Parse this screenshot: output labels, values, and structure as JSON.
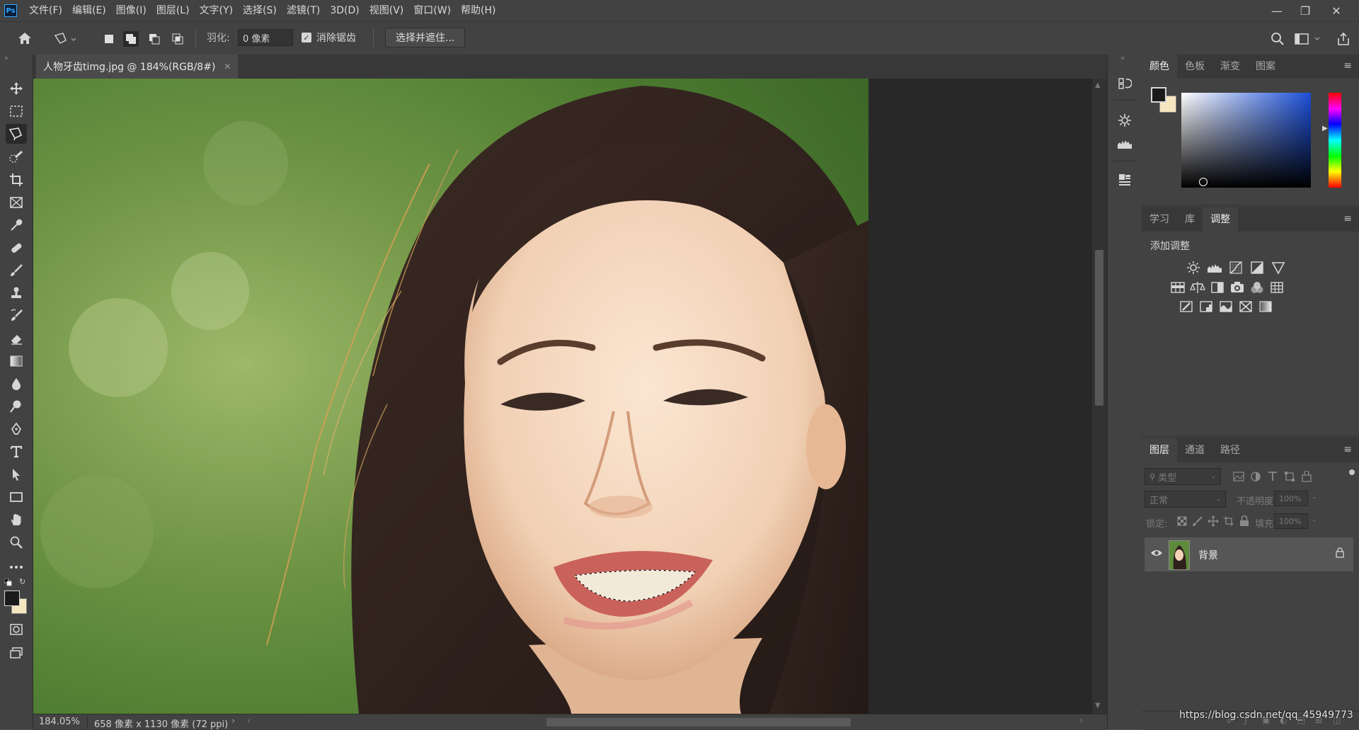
{
  "app": {
    "logo": "Ps"
  },
  "menu": [
    "文件(F)",
    "编辑(E)",
    "图像(I)",
    "图层(L)",
    "文字(Y)",
    "选择(S)",
    "滤镜(T)",
    "3D(D)",
    "视图(V)",
    "窗口(W)",
    "帮助(H)"
  ],
  "options": {
    "feather_label": "羽化:",
    "feather_value": "0 像素",
    "antialias_label": "消除锯齿",
    "antialias_checked": true,
    "select_mask_label": "选择并遮住..."
  },
  "document": {
    "tab_title": "人物牙齿timg.jpg @ 184%(RGB/8#)",
    "zoom": "184.05%",
    "info": "658 像素 x 1130 像素 (72 ppi)"
  },
  "color_panel": {
    "tabs": [
      "颜色",
      "色板",
      "渐变",
      "图案"
    ],
    "active": 0,
    "foreground": "#1a1a1a",
    "background": "#f5e6c0",
    "hue_color": "#1b4fd8"
  },
  "adjust_panel": {
    "tabs": [
      "学习",
      "库",
      "调整"
    ],
    "active": 2,
    "heading": "添加调整"
  },
  "layers_panel": {
    "tabs": [
      "图层",
      "通道",
      "路径"
    ],
    "active": 0,
    "filter_placeholder": "类型",
    "blend_mode": "正常",
    "opacity_label": "不透明度:",
    "opacity_value": "100%",
    "lock_label": "锁定:",
    "fill_label": "填充:",
    "fill_value": "100%",
    "layers": [
      {
        "name": "背景",
        "visible": true,
        "locked": true
      }
    ]
  },
  "watermark": "https://blog.csdn.net/qq_45949773"
}
